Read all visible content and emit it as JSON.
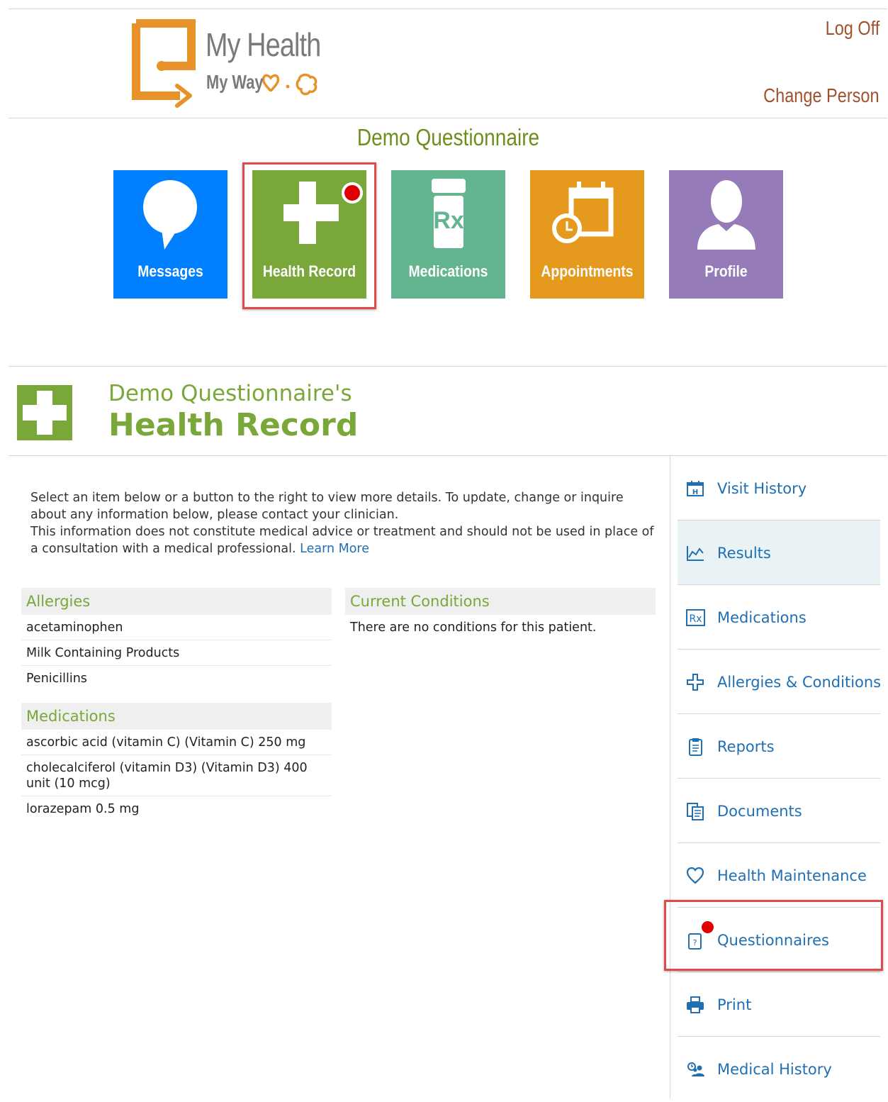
{
  "header": {
    "logo_title": "My Health",
    "logo_subtitle": "My Way",
    "log_off": "Log Off",
    "change_person": "Change Person",
    "patient_name": "Demo Questionnaire"
  },
  "tiles": [
    {
      "label": "Messages",
      "color": "#0080ff",
      "icon": "speech-bubble-icon"
    },
    {
      "label": "Health Record",
      "color": "#7aa73a",
      "icon": "medical-cross-icon",
      "selected": true,
      "notification": true
    },
    {
      "label": "Medications",
      "color": "#62b58f",
      "icon": "rx-bottle-icon"
    },
    {
      "label": "Appointments",
      "color": "#e59a1d",
      "icon": "calendar-clock-icon"
    },
    {
      "label": "Profile",
      "color": "#957cb8",
      "icon": "person-icon"
    }
  ],
  "section": {
    "subtitle": "Demo Questionnaire's",
    "title": "Health Record",
    "icon": "medical-cross-icon"
  },
  "info": {
    "line1": "Select an item below or a button to the right to view more details. To update, change or inquire about any information below, please contact your clinician.",
    "line2": "This information does not constitute medical advice or treatment and should not be used in place of a consultation with a medical professional.",
    "learn_more": "Learn More"
  },
  "allergies": {
    "header": "Allergies",
    "items": [
      "acetaminophen",
      "Milk Containing Products",
      "Penicillins"
    ]
  },
  "medications": {
    "header": "Medications",
    "items": [
      "ascorbic acid (vitamin C) (Vitamin C) 250 mg",
      "cholecalciferol (vitamin D3) (Vitamin D3) 400 unit (10 mcg)",
      "lorazepam 0.5 mg"
    ]
  },
  "conditions": {
    "header": "Current Conditions",
    "empty_text": "There are no conditions for this patient."
  },
  "sidenav": [
    {
      "label": "Visit History",
      "icon": "hospital-calendar-icon"
    },
    {
      "label": "Results",
      "icon": "line-chart-icon",
      "active": true
    },
    {
      "label": "Medications",
      "icon": "rx-icon"
    },
    {
      "label": "Allergies & Conditions",
      "icon": "cross-outline-icon"
    },
    {
      "label": "Reports",
      "icon": "clipboard-icon"
    },
    {
      "label": "Documents",
      "icon": "documents-icon"
    },
    {
      "label": "Health Maintenance",
      "icon": "heart-icon"
    },
    {
      "label": "Questionnaires",
      "icon": "question-clipboard-icon",
      "selected": true,
      "notification": true
    },
    {
      "label": "Print",
      "icon": "printer-icon"
    },
    {
      "label": "Medical History",
      "icon": "family-history-icon"
    }
  ],
  "colors": {
    "accent_green": "#7aa73a",
    "link_blue": "#1f6fb2",
    "header_link": "#a0522d",
    "selection_red": "#e04a4a",
    "logo_orange": "#e8922a"
  }
}
